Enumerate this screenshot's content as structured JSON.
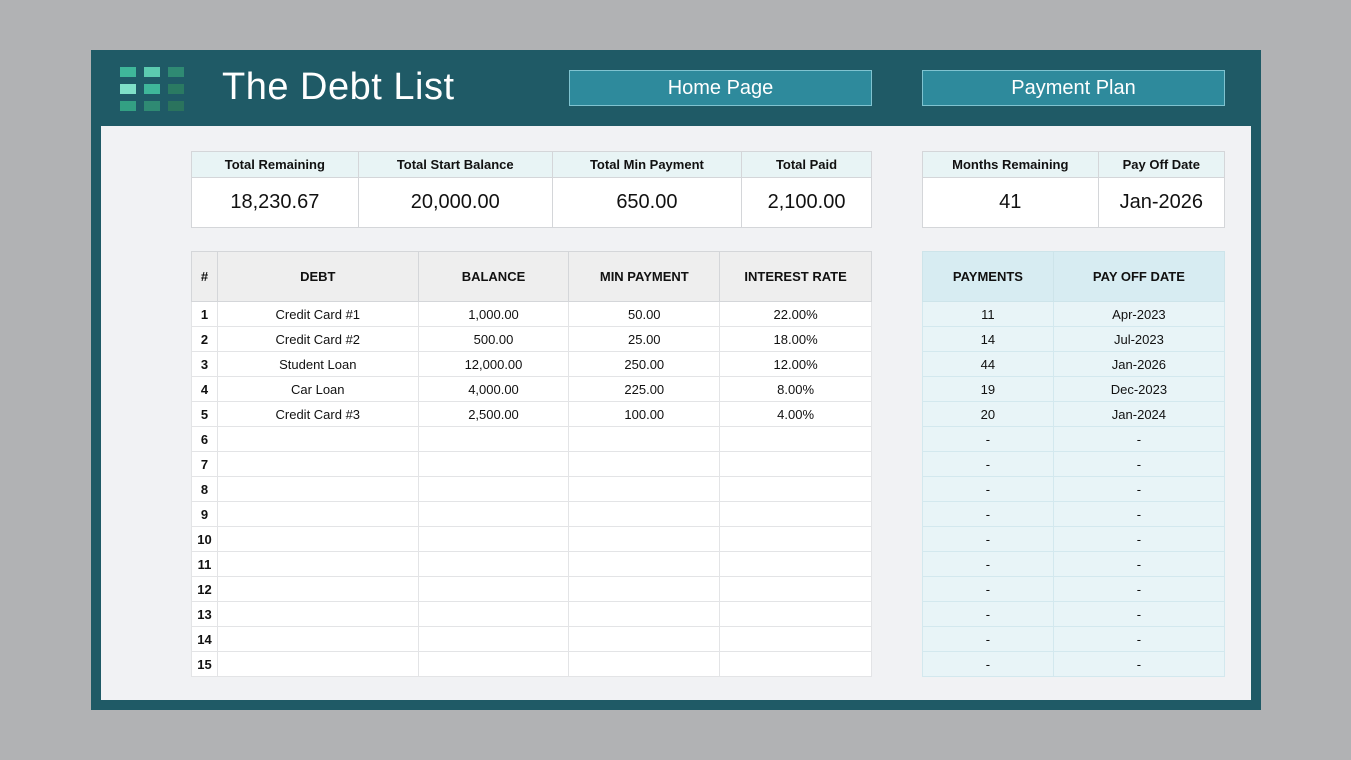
{
  "header": {
    "title": "The Debt List",
    "buttons": [
      "Home Page",
      "Payment Plan"
    ]
  },
  "colors": {
    "frame": "#1f5a66",
    "button": "#2e8a9c",
    "background": "#f1f2f4"
  },
  "summary": {
    "headers": [
      "Total Remaining",
      "Total Start Balance",
      "Total Min Payment",
      "Total Paid"
    ],
    "values": [
      "18,230.67",
      "20,000.00",
      "650.00",
      "2,100.00"
    ]
  },
  "summary2": {
    "headers": [
      "Months Remaining",
      "Pay Off Date"
    ],
    "values": [
      "41",
      "Jan-2026"
    ]
  },
  "debts": {
    "headers": [
      "#",
      "DEBT",
      "BALANCE",
      "MIN PAYMENT",
      "INTEREST RATE"
    ],
    "rows": [
      [
        "1",
        "Credit Card #1",
        "1,000.00",
        "50.00",
        "22.00%"
      ],
      [
        "2",
        "Credit Card #2",
        "500.00",
        "25.00",
        "18.00%"
      ],
      [
        "3",
        "Student Loan",
        "12,000.00",
        "250.00",
        "12.00%"
      ],
      [
        "4",
        "Car Loan",
        "4,000.00",
        "225.00",
        "8.00%"
      ],
      [
        "5",
        "Credit Card #3",
        "2,500.00",
        "100.00",
        "4.00%"
      ],
      [
        "6",
        "",
        "",
        "",
        ""
      ],
      [
        "7",
        "",
        "",
        "",
        ""
      ],
      [
        "8",
        "",
        "",
        "",
        ""
      ],
      [
        "9",
        "",
        "",
        "",
        ""
      ],
      [
        "10",
        "",
        "",
        "",
        ""
      ],
      [
        "11",
        "",
        "",
        "",
        ""
      ],
      [
        "12",
        "",
        "",
        "",
        ""
      ],
      [
        "13",
        "",
        "",
        "",
        ""
      ],
      [
        "14",
        "",
        "",
        "",
        ""
      ],
      [
        "15",
        "",
        "",
        "",
        ""
      ]
    ]
  },
  "payoff": {
    "headers": [
      "PAYMENTS",
      "PAY OFF DATE"
    ],
    "rows": [
      [
        "11",
        "Apr-2023"
      ],
      [
        "14",
        "Jul-2023"
      ],
      [
        "44",
        "Jan-2026"
      ],
      [
        "19",
        "Dec-2023"
      ],
      [
        "20",
        "Jan-2024"
      ],
      [
        "-",
        "-"
      ],
      [
        "-",
        "-"
      ],
      [
        "-",
        "-"
      ],
      [
        "-",
        "-"
      ],
      [
        "-",
        "-"
      ],
      [
        "-",
        "-"
      ],
      [
        "-",
        "-"
      ],
      [
        "-",
        "-"
      ],
      [
        "-",
        "-"
      ],
      [
        "-",
        "-"
      ]
    ]
  }
}
